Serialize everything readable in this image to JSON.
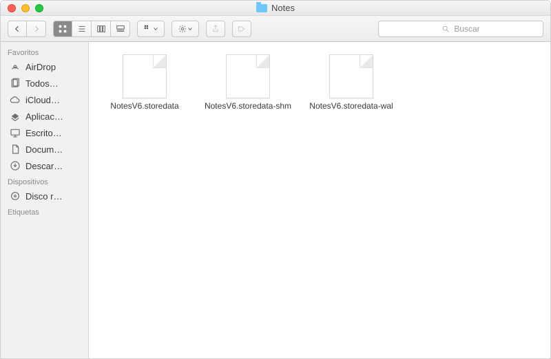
{
  "window": {
    "title": "Notes"
  },
  "toolbar": {
    "search_placeholder": "Buscar"
  },
  "sidebar": {
    "sections": [
      {
        "heading": "Favoritos",
        "items": [
          {
            "icon": "airdrop-icon",
            "label": "AirDrop"
          },
          {
            "icon": "all-files-icon",
            "label": "Todos…"
          },
          {
            "icon": "icloud-icon",
            "label": "iCloud…"
          },
          {
            "icon": "applications-icon",
            "label": "Aplicac…"
          },
          {
            "icon": "desktop-icon",
            "label": "Escrito…"
          },
          {
            "icon": "documents-icon",
            "label": "Docum…"
          },
          {
            "icon": "downloads-icon",
            "label": "Descar…"
          }
        ]
      },
      {
        "heading": "Dispositivos",
        "items": [
          {
            "icon": "disk-icon",
            "label": "Disco r…"
          }
        ]
      },
      {
        "heading": "Etiquetas",
        "items": []
      }
    ]
  },
  "files": [
    {
      "name": "NotesV6.storedata"
    },
    {
      "name": "NotesV6.storedata-shm"
    },
    {
      "name": "NotesV6.storedata-wal"
    }
  ]
}
